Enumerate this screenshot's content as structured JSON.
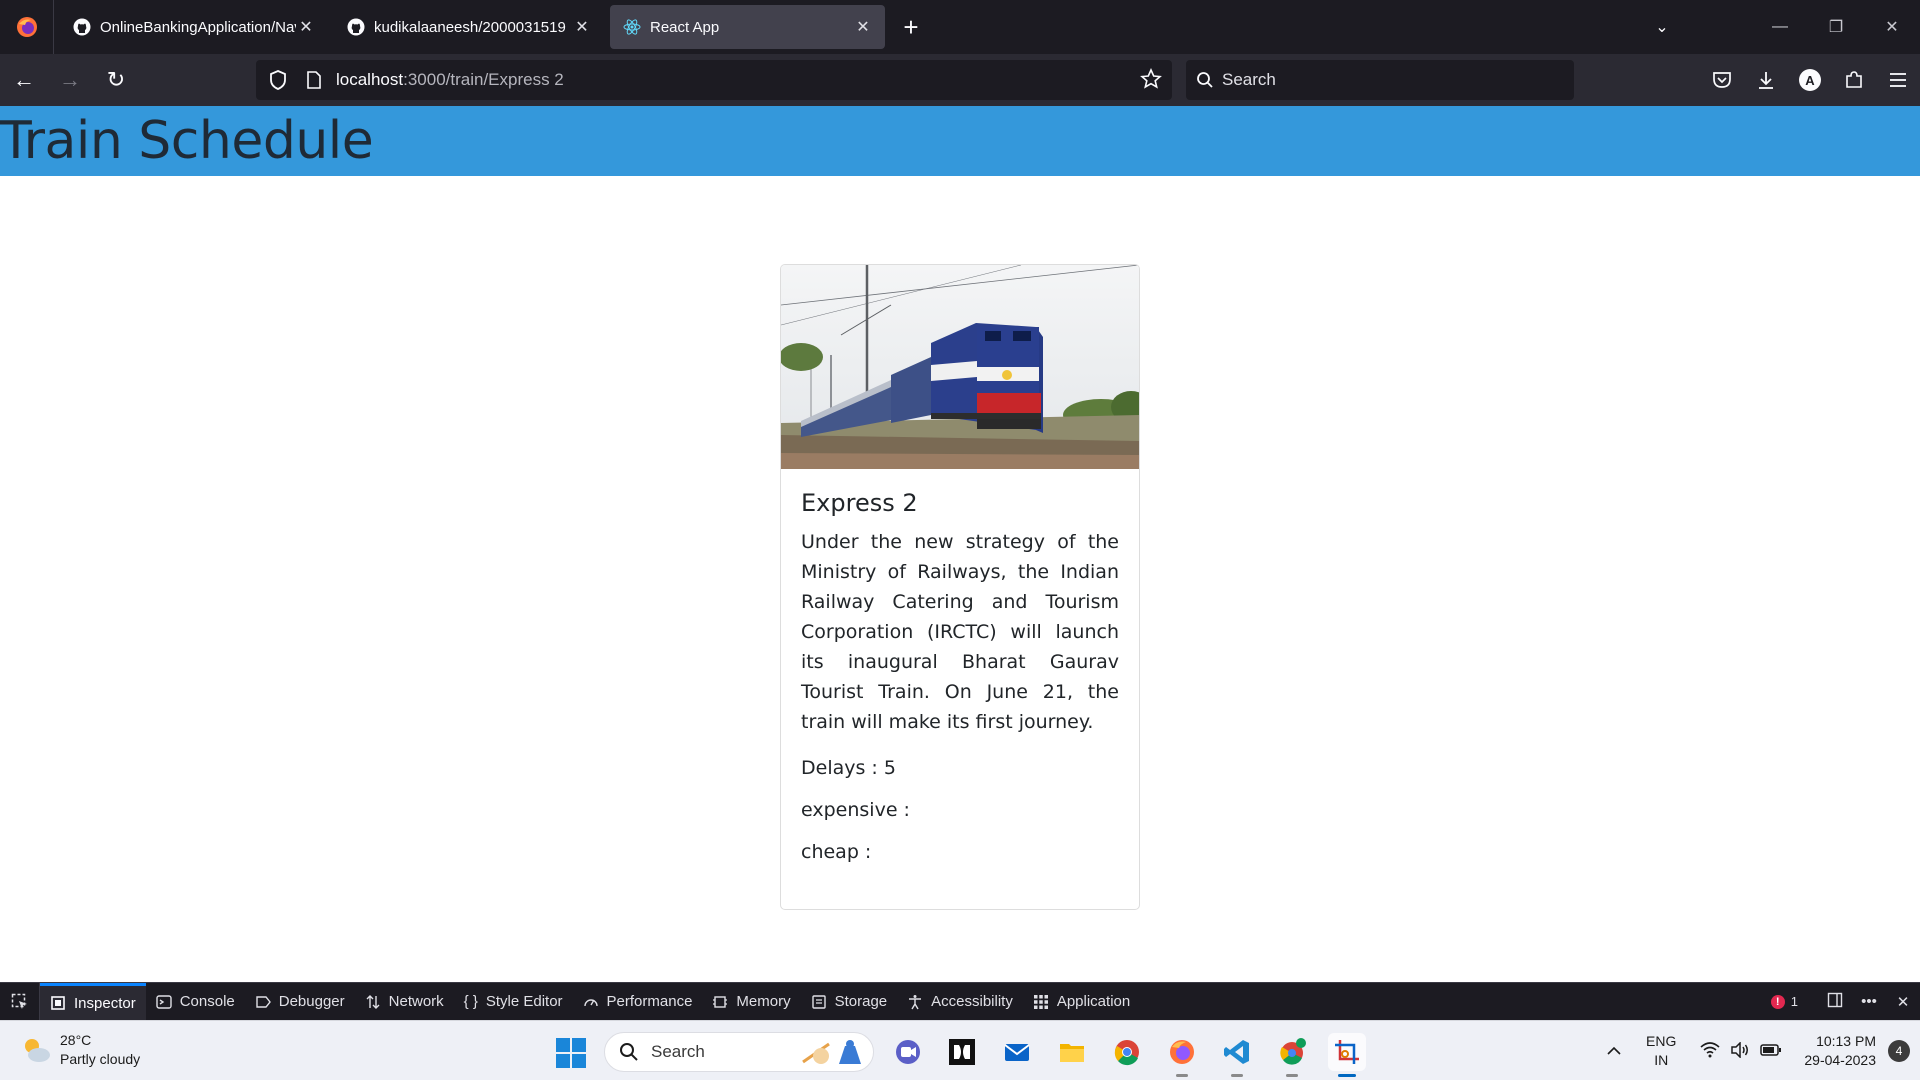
{
  "browser": {
    "tabs": [
      {
        "title": "OnlineBankingApplication/Navi",
        "icon": "github-icon"
      },
      {
        "title": "kudikalaaneesh/2000031519",
        "icon": "github-icon"
      },
      {
        "title": "React App",
        "icon": "react-icon",
        "active": true
      }
    ],
    "new_tab": "+",
    "url_host": "localhost",
    "url_path": ":3000/train/Express 2",
    "search_placeholder": "Search",
    "profile_initial": "A"
  },
  "app": {
    "title": "Train Schedule",
    "card": {
      "image_alt": "train-photo",
      "name": "Express 2",
      "description": "Under the new strategy of the Ministry of Railways, the Indian Railway Catering and Tourism Corporation (IRCTC) will launch its inaugural Bharat Gaurav Tourist Train. On June 21, the train will make its first journey.",
      "delays": "Delays : 5",
      "expensive": "expensive :",
      "cheap": "cheap :"
    },
    "colors": {
      "header": "#3498db"
    }
  },
  "devtools": {
    "tabs": [
      "Inspector",
      "Console",
      "Debugger",
      "Network",
      "Style Editor",
      "Performance",
      "Memory",
      "Storage",
      "Accessibility",
      "Application"
    ],
    "active_tab": "Inspector",
    "error_count": "1"
  },
  "taskbar": {
    "temperature": "28°C",
    "weather": "Partly cloudy",
    "search_label": "Search",
    "lang_top": "ENG",
    "lang_bottom": "IN",
    "time": "10:13 PM",
    "date": "29-04-2023",
    "notifications": "4"
  }
}
